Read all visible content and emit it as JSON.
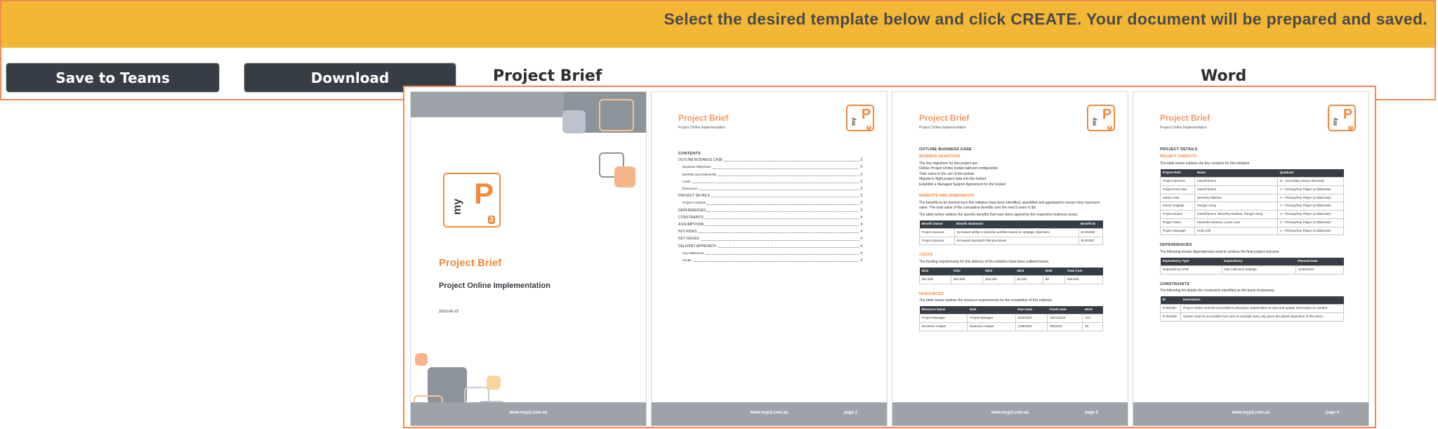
{
  "banner": {
    "text": "Select the desired template below and click CREATE. Your document will be prepared and saved."
  },
  "toolbar": {
    "save_label": "Save to Teams",
    "download_label": "Download",
    "doc_name": "Project Brief",
    "doc_type": "Word"
  },
  "colors": {
    "banner": "#f2b835",
    "accent": "#ef8a3c",
    "dark": "#373d45",
    "border": "#ef8a52"
  },
  "logo": {
    "my": "my",
    "p": "P",
    "three": "3"
  },
  "doc": {
    "title": "Project Brief",
    "subtitle": "Project Online Implementation",
    "date": "2023-06-22",
    "footer_url": "www.myp3.com.au",
    "footer_page": "page",
    "pages": [
      "2",
      "3",
      "4"
    ]
  },
  "toc": {
    "heading": "CONTENTS",
    "items": [
      {
        "label": "OUTLINE BUSINESS CASE",
        "page": "3",
        "sub": false
      },
      {
        "label": "Business Objectives",
        "page": "3",
        "sub": true
      },
      {
        "label": "Benefits and Disbenefits",
        "page": "3",
        "sub": true
      },
      {
        "label": "Costs",
        "page": "3",
        "sub": true
      },
      {
        "label": "Resources",
        "page": "3",
        "sub": true
      },
      {
        "label": "PROJECT DETAILS",
        "page": "3",
        "sub": false
      },
      {
        "label": "Project Contacts",
        "page": "3",
        "sub": true
      },
      {
        "label": "DEPENDENCIES",
        "page": "3",
        "sub": false
      },
      {
        "label": "CONSTRAINTS",
        "page": "4",
        "sub": false
      },
      {
        "label": "ASSUMPTIONS",
        "page": "4",
        "sub": false
      },
      {
        "label": "KEY RISKS",
        "page": "4",
        "sub": false
      },
      {
        "label": "KEY ISSUES",
        "page": "4",
        "sub": false
      },
      {
        "label": "DELIVERY APPROACH",
        "page": "4",
        "sub": false
      },
      {
        "label": "Key Milestones",
        "page": "4",
        "sub": true
      },
      {
        "label": "Scope",
        "page": "4",
        "sub": true
      }
    ]
  },
  "page3": {
    "section": "OUTLINE BUSINESS CASE",
    "objectives_heading": "BUSINESS OBJECTIVES",
    "objectives_intro": "The key objectives for this project are:",
    "objectives": [
      "Deliver Project Online toolset tailored configuration",
      "Train users in the use of the toolset",
      "Migrate in flight project data into the toolset",
      "Establish a Managed Support Agreement for the toolset"
    ],
    "benefits_heading": "BENEFITS AND DISBENEFITS",
    "benefits_para1": "The benefits to be derived from this initiative have been identified, quantified and appraised to ensure they represent value. The total value of the cumulative benefits over the next 5 years is $X.",
    "benefits_para2": "The table below outlines the specific benefits that have been agreed by the respective business areas.",
    "benefits_table": {
      "headers": [
        "Benefit Owner",
        "Benefit Statement",
        "Benefit ID"
      ],
      "rows": [
        [
          "Project Sponsor",
          "Increased ability to prioritise portfolio based on strategic objectives",
          "B-001056"
        ],
        [
          "Project Sponsor",
          "Increased standard P3M processes",
          "B-001057"
        ]
      ]
    },
    "costs_heading": "COSTS",
    "costs_para": "The funding requirements for this delivery of this initiative have been outlined below.",
    "costs_table": {
      "headers": [
        "2021",
        "2022",
        "2023",
        "2024",
        "2025",
        "Total Cost"
      ],
      "rows": [
        [
          "$10,000",
          "$22,800",
          "$15,200",
          "$1,000",
          "$0",
          "$49,000"
        ]
      ]
    },
    "resources_heading": "RESOURCES",
    "resources_para": "The table below outlines the resource requirements for the completion of this initiative.",
    "resources_table": {
      "headers": [
        "Resource Name",
        "Role",
        "Start Date",
        "Finish Date",
        "Work"
      ],
      "rows": [
        [
          "Project Manager",
          "Project Manager",
          "5/16/2022",
          "10/21/2024",
          "312"
        ],
        [
          "Business Analyst",
          "Business Analyst",
          "10/5/2022",
          "3/8/2023",
          "80"
        ]
      ]
    }
  },
  "page4": {
    "section": "PROJECT DETAILS",
    "contacts_heading": "PROJECT CONTACTS",
    "contacts_para": "The table below outlines the key contacts for this initiative.",
    "contacts_table": {
      "headers": [
        "Project Role",
        "Name",
        "Quadrant"
      ],
      "rows": [
        [
          "Project Sponsor",
          "Danell Benns",
          "D - Secondary (Keep Informed)"
        ],
        [
          "Project Executive",
          "Danell Benns",
          "A - Primary/Key Player (Collaborate)"
        ],
        [
          "Senior User",
          "Beverley Mathias",
          "A - Primary/Key Player (Collaborate)"
        ],
        [
          "Senior Supplier",
          "Ranger Song",
          "A - Primary/Key Player (Collaborate)"
        ],
        [
          "Project Board",
          "Danell Benns, Beverley Mathias, Ranger Song",
          "A - Primary/Key Player (Collaborate)"
        ],
        [
          "Project Team",
          "Monesha Sharma, Lucas Lace",
          "A - Primary/Key Player (Collaborate)"
        ],
        [
          "Project Manager",
          "Kelly Clift",
          "A - Primary/Key Player (Collaborate)"
        ]
      ]
    },
    "dependencies_heading": "DEPENDENCIES",
    "dependencies_para": "The following known dependencies exist to achieve the final project outcome",
    "dependencies_table": {
      "headers": [
        "Dependency Type",
        "Dependency",
        "Planned Date"
      ],
      "rows": [
        [
          "Dependency GIVE",
          "Site Collection Settings",
          "11/30/2023"
        ]
      ]
    },
    "constraints_heading": "CONSTRAINTS",
    "constraints_para": "The following list details the constraints identified as the basis of planning:",
    "constraints_table": {
      "headers": [
        "ID",
        "Description"
      ],
      "rows": [
        [
          "R-001367",
          "Project Online must be accessible to all project stakeholders to view and update information as needed"
        ],
        [
          "R-001368",
          "system must be accessible from 5am to midnight every day given the global separation of the teams"
        ]
      ]
    }
  }
}
